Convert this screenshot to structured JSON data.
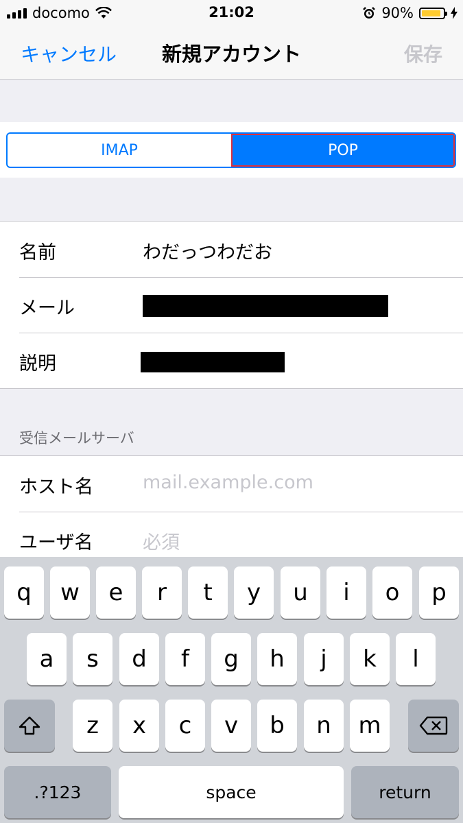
{
  "status_bar": {
    "carrier": "docomo",
    "time": "21:02",
    "battery": "90%",
    "battery_level": 0.9,
    "icons": [
      "signal-icon",
      "wifi-icon",
      "alarm-icon",
      "battery-icon",
      "charging-bolt-icon"
    ]
  },
  "nav": {
    "cancel": "キャンセル",
    "title": "新規アカウント",
    "save": "保存"
  },
  "segment": {
    "options": [
      "IMAP",
      "POP"
    ],
    "selected": "POP"
  },
  "account": {
    "name_label": "名前",
    "name_value": "わだっつわだお",
    "email_label": "メール",
    "description_label": "説明"
  },
  "incoming": {
    "header": "受信メールサーバ",
    "host_label": "ホスト名",
    "host_placeholder": "mail.example.com",
    "user_label": "ユーザ名",
    "user_placeholder": "必須"
  },
  "keyboard": {
    "row1": [
      "q",
      "w",
      "e",
      "r",
      "t",
      "y",
      "u",
      "i",
      "o",
      "p"
    ],
    "row2": [
      "a",
      "s",
      "d",
      "f",
      "g",
      "h",
      "j",
      "k",
      "l"
    ],
    "row3": [
      "z",
      "x",
      "c",
      "v",
      "b",
      "n",
      "m"
    ],
    "numbers": ".?123",
    "space": "space",
    "return": "return"
  },
  "colors": {
    "accent": "#007aff",
    "selection_outline": "#e0303a",
    "battery": "#fecb2f"
  }
}
